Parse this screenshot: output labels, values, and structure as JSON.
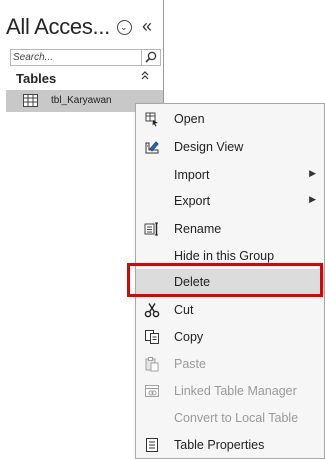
{
  "nav": {
    "title": "All Acces...",
    "collapse_glyph": "«",
    "search_placeholder": "Search...",
    "group_label": "Tables",
    "group_collapse_glyph": "⌃",
    "table_item_label": "tbl_Karyawan"
  },
  "context_menu": {
    "items": [
      {
        "label": "Open",
        "icon": "open-table-icon"
      },
      {
        "label": "Design View",
        "icon": "design-view-icon"
      },
      {
        "label": "Import",
        "icon": "",
        "submenu": true
      },
      {
        "label": "Export",
        "icon": "",
        "submenu": true
      },
      {
        "label": "Rename",
        "icon": "rename-icon"
      },
      {
        "label": "Hide in this Group",
        "icon": ""
      },
      {
        "label": "Delete",
        "icon": "",
        "highlighted": true
      },
      {
        "label": "Cut",
        "icon": "scissors-icon"
      },
      {
        "label": "Copy",
        "icon": "copy-icon"
      },
      {
        "label": "Paste",
        "icon": "paste-icon",
        "disabled": true
      },
      {
        "label": "Linked Table Manager",
        "icon": "linked-table-manager-icon",
        "disabled": true
      },
      {
        "label": "Convert to Local Table",
        "icon": "",
        "disabled": true
      },
      {
        "label": "Table Properties",
        "icon": "table-properties-icon"
      }
    ],
    "submenu_arrow": "▶"
  },
  "colors": {
    "highlight_outline": "#e30000",
    "selected_item_bg": "#c8c8c8",
    "menu_bg": "#f6f6f6",
    "disabled_text": "#9a9a9a"
  }
}
